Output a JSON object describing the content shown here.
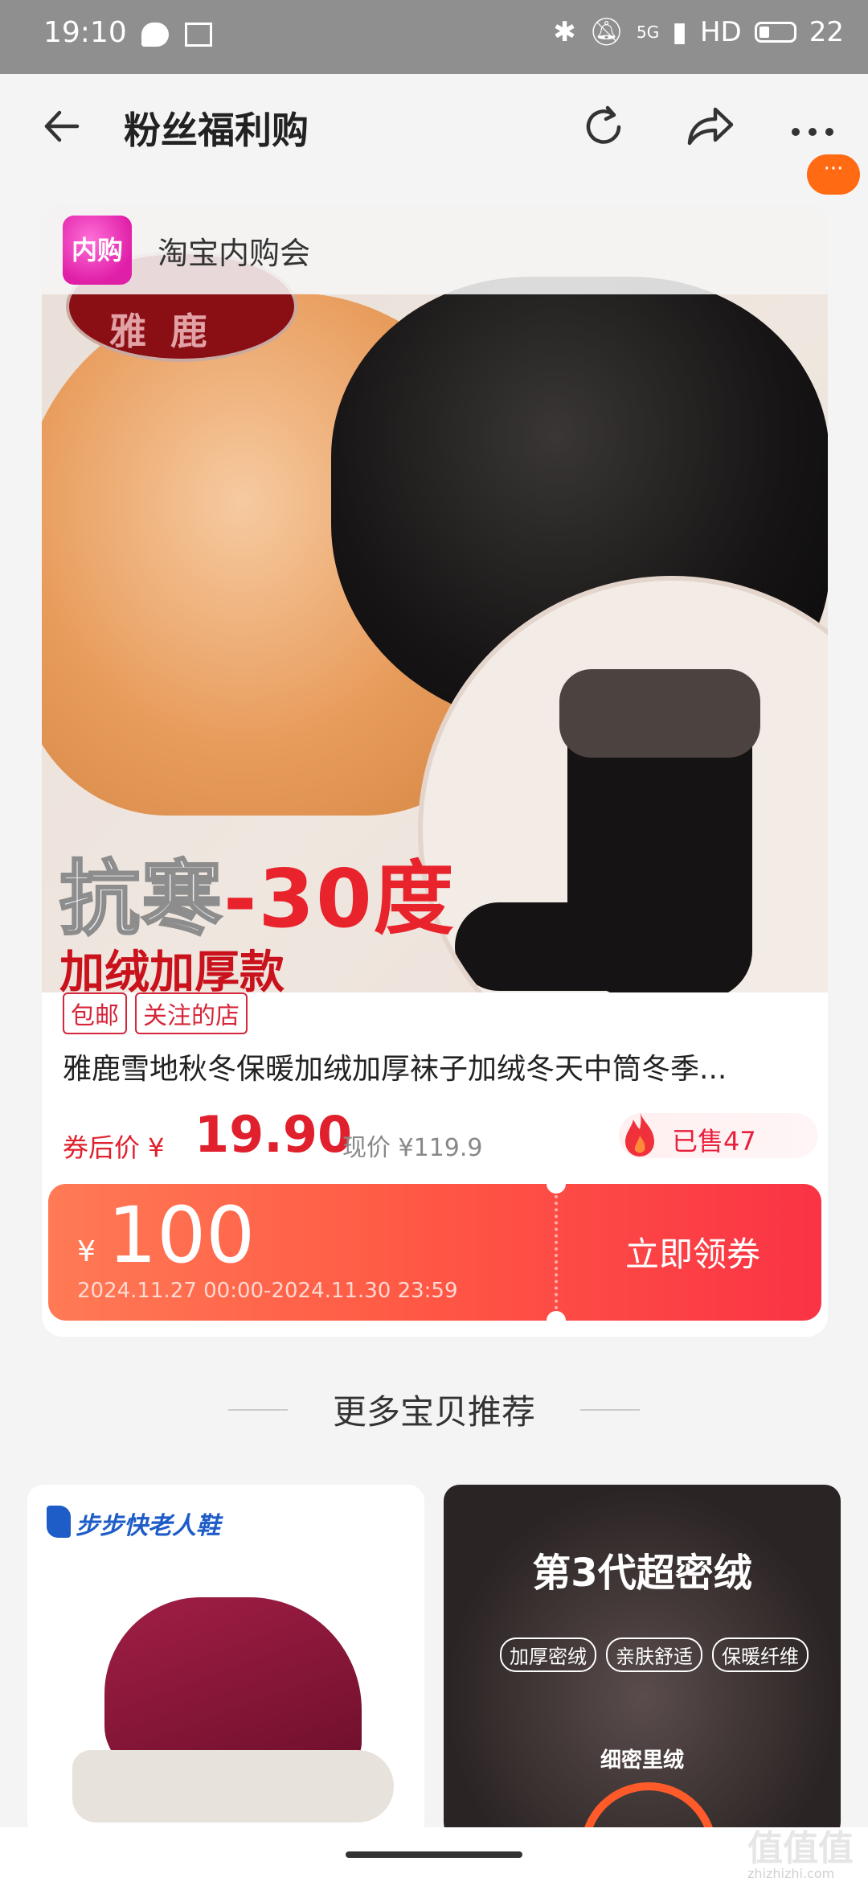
{
  "status_bar": {
    "time": "19:10",
    "network": "5G",
    "hd": "HD",
    "battery": "22"
  },
  "header": {
    "title": "粉丝福利购",
    "more_badge": "···",
    "icons": [
      "back-arrow-icon",
      "refresh-icon",
      "share-icon",
      "more-icon"
    ]
  },
  "product": {
    "shop_badge": "内购",
    "shop_name": "淘宝内购会",
    "brand_logo": "雅鹿",
    "promo_text_gray": "抗寒",
    "promo_text_red": "-30度",
    "promo_sub": "加绒加厚款",
    "tags": [
      "包邮",
      "关注的店"
    ],
    "title": "雅鹿雪地秋冬保暖加绒加厚袜子加绒冬天中筒冬季...",
    "price_label": "券后价 ¥",
    "price_value": "19.90",
    "original_price": "现价 ¥119.9",
    "sold": "已售47"
  },
  "coupon": {
    "currency": "¥",
    "amount": "100",
    "validity": "2024.11.27 00:00-2024.11.30 23:59",
    "claim_label": "立即领券"
  },
  "more_section": {
    "heading": "更多宝贝推荐"
  },
  "recommendations": [
    {
      "brand": "步步快老人鞋"
    },
    {
      "headline": "第3代超密绒",
      "tags": [
        "加厚密绒",
        "亲肤舒适",
        "保暖纤维"
      ],
      "sub": "细密里绒"
    }
  ],
  "watermark": {
    "text": "值值值",
    "site": "zhizhizhi.com"
  },
  "colors": {
    "accent_red": "#e0202c",
    "coupon_start": "#ff7a55",
    "coupon_end": "#fa3345",
    "status_bar": "#8f8f8f"
  }
}
